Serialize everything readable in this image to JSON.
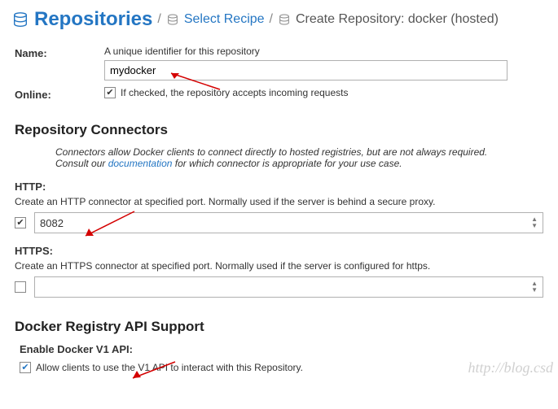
{
  "breadcrumb": {
    "root": "Repositories",
    "step1": "Select Recipe",
    "current": "Create Repository: docker (hosted)"
  },
  "name": {
    "label": "Name:",
    "hint": "A unique identifier for this repository",
    "value": "mydocker"
  },
  "online": {
    "label": "Online:",
    "checked": true,
    "text": "If checked, the repository accepts incoming requests"
  },
  "connectors": {
    "title": "Repository Connectors",
    "desc_before": "Connectors allow Docker clients to connect directly to hosted registries, but are not always required. Consult our ",
    "desc_link": "documentation",
    "desc_after": " for which connector is appropriate for your use case.",
    "http": {
      "label": "HTTP:",
      "hint": "Create an HTTP connector at specified port. Normally used if the server is behind a secure proxy.",
      "checked": true,
      "value": "8082"
    },
    "https": {
      "label": "HTTPS:",
      "hint": "Create an HTTPS connector at specified port. Normally used if the server is configured for https.",
      "checked": false,
      "value": ""
    }
  },
  "api": {
    "title": "Docker Registry API Support",
    "sub": "Enable Docker V1 API:",
    "checked": true,
    "text": "Allow clients to use the V1 API to interact with this Repository."
  },
  "watermark": "http://blog.csd"
}
